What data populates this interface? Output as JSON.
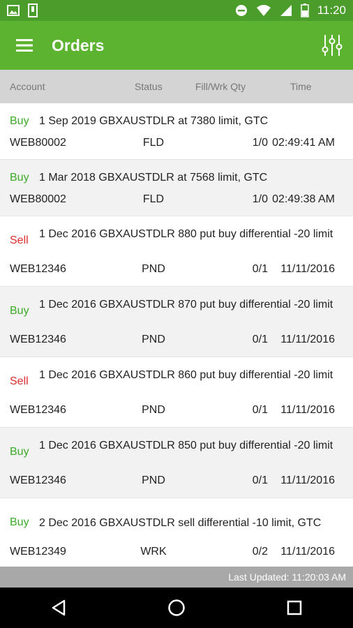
{
  "status_bar": {
    "time": "11:20",
    "icons": [
      "gallery-icon",
      "sim-icon",
      "do-not-disturb-icon",
      "wifi-icon",
      "signal-icon",
      "battery-icon"
    ]
  },
  "app_bar": {
    "title": "Orders",
    "background": "#5cb32f"
  },
  "columns": {
    "account": "Account",
    "status": "Status",
    "fill_qty": "Fill/Wrk Qty",
    "time": "Time"
  },
  "orders": [
    {
      "side": "Buy",
      "desc": "1 Sep 2019 GBXAUSTDLR at 7380 limit, GTC",
      "account": "WEB80002",
      "status": "FLD",
      "qty": "1/0",
      "time": "02:49:41 AM"
    },
    {
      "side": "Buy",
      "desc": "1 Mar 2018 GBXAUSTDLR at 7568 limit, GTC",
      "account": "WEB80002",
      "status": "FLD",
      "qty": "1/0",
      "time": "02:49:38 AM"
    },
    {
      "side": "Sell",
      "desc": "1 Dec 2016 GBXAUSTDLR 880 put buy differential -20 limit",
      "account": "WEB12346",
      "status": "PND",
      "qty": "0/1",
      "time": "11/11/2016"
    },
    {
      "side": "Buy",
      "desc": "1 Dec 2016 GBXAUSTDLR 870 put buy differential -20 limit",
      "account": "WEB12346",
      "status": "PND",
      "qty": "0/1",
      "time": "11/11/2016"
    },
    {
      "side": "Sell",
      "desc": "1 Dec 2016 GBXAUSTDLR 860 put buy differential -20 limit",
      "account": "WEB12346",
      "status": "PND",
      "qty": "0/1",
      "time": "11/11/2016"
    },
    {
      "side": "Buy",
      "desc": "1 Dec 2016 GBXAUSTDLR 850 put buy differential -20 limit",
      "account": "WEB12346",
      "status": "PND",
      "qty": "0/1",
      "time": "11/11/2016"
    },
    {
      "side": "Buy",
      "desc": "2 Dec 2016 GBXAUSTDLR sell differential -10 limit, GTC",
      "account": "WEB12349",
      "status": "WRK",
      "qty": "0/2",
      "time": "11/11/2016"
    }
  ],
  "footer": {
    "last_updated": "Last Updated: 11:20:03 AM"
  },
  "colors": {
    "buy": "#3caa28",
    "sell": "#e02d2d",
    "header_bg": "#d4d4d4"
  }
}
